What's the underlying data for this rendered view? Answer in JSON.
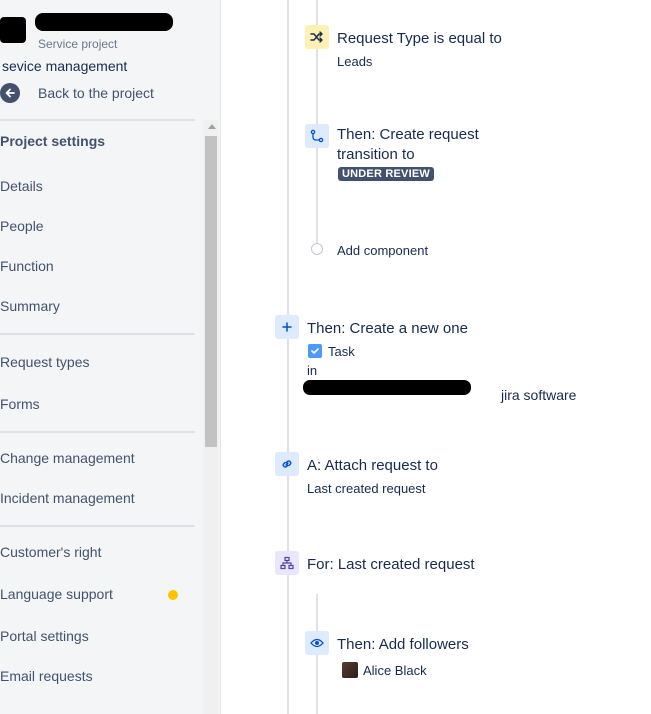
{
  "sidebar": {
    "project_type": "Service project",
    "project_name": "sevice management",
    "back_label": "Back to the project",
    "heading": "Project settings",
    "items": [
      {
        "label": "Details"
      },
      {
        "label": "People"
      },
      {
        "label": "Function"
      },
      {
        "label": "Summary"
      },
      {
        "label": "Request types"
      },
      {
        "label": "Forms"
      },
      {
        "label": "Change management"
      },
      {
        "label": "Incident management"
      },
      {
        "label": "Customer's right"
      },
      {
        "label": "Language support"
      },
      {
        "label": "Portal settings"
      },
      {
        "label": "Email requests"
      }
    ],
    "badge_color": "#ffc400"
  },
  "rules": {
    "condition": {
      "title": "Request Type is equal to",
      "value": "Leads",
      "icon": "shuffle-icon"
    },
    "transition": {
      "title_line1": "Then: Create request",
      "title_line2": "transition to",
      "status": "UNDER REVIEW",
      "icon": "transition-icon"
    },
    "add_component": "Add component",
    "create": {
      "title": "Then: Create a new one",
      "issue_type": "Task",
      "in_label": "in",
      "project_suffix": "jira software",
      "icon": "plus-icon"
    },
    "attach": {
      "title": "A: Attach request to",
      "value": "Last created request",
      "icon": "link-icon"
    },
    "branch": {
      "title": "For: Last created request",
      "icon": "branch-icon"
    },
    "followers": {
      "title": "Then: Add followers",
      "user": "Alice Black",
      "icon": "eye-icon"
    }
  },
  "colors": {
    "condition_bg": "#fff0b3",
    "action_bg": "#deebff",
    "branch_bg": "#eae6ff",
    "lozenge": "#42526e"
  }
}
